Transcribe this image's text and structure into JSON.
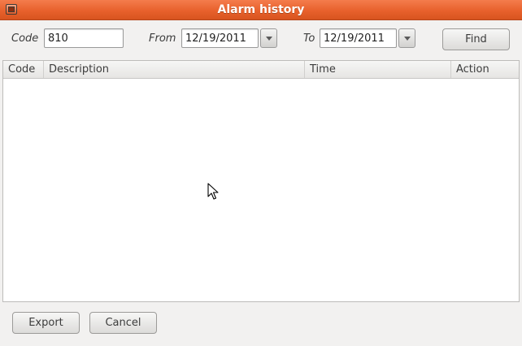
{
  "window": {
    "title": "Alarm history"
  },
  "filters": {
    "code_label": "Code",
    "code_value": "810",
    "from_label": "From",
    "from_value": "12/19/2011",
    "to_label": "To",
    "to_value": "12/19/2011",
    "find_label": "Find"
  },
  "table": {
    "columns": [
      "Code",
      "Description",
      "Time",
      "Action"
    ],
    "rows": []
  },
  "footer": {
    "export_label": "Export",
    "cancel_label": "Cancel"
  },
  "colors": {
    "titlebar": "#e8612c",
    "window_bg": "#f2f1f0"
  },
  "icons": {
    "close": "close-icon",
    "dropdown": "chevron-down-icon",
    "cursor": "mouse-pointer-icon"
  }
}
